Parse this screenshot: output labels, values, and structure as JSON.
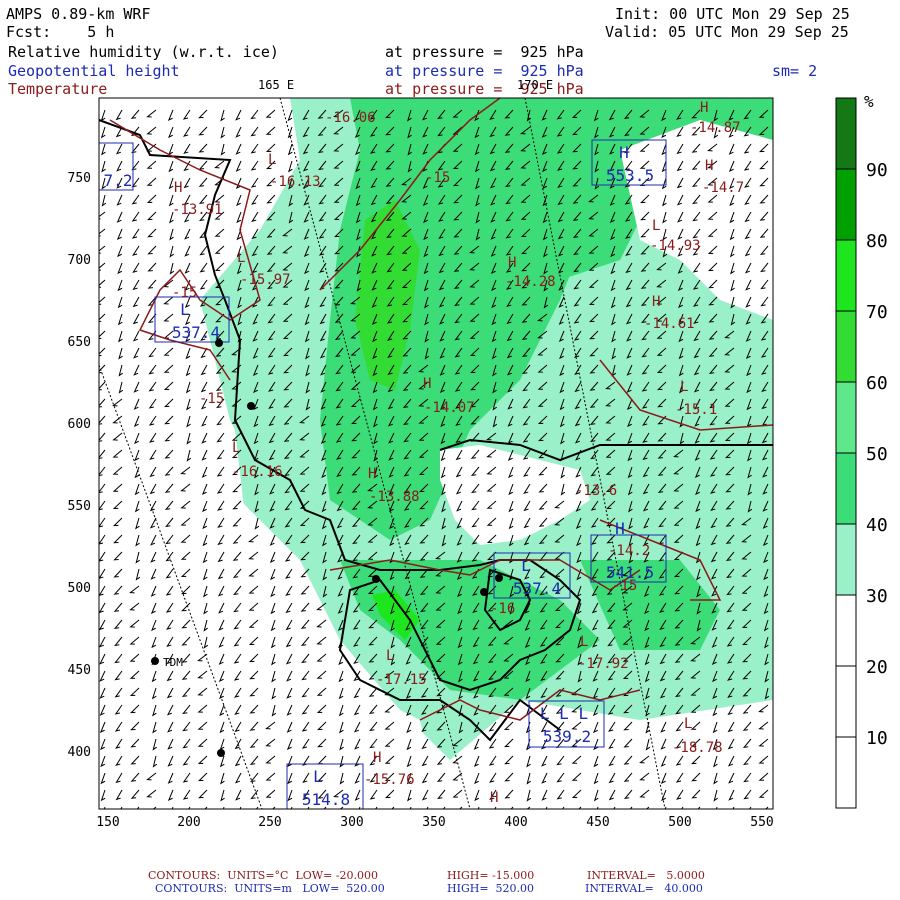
{
  "header": {
    "model": "AMPS 0.89-km WRF",
    "fcst": "Fcst:    5 h",
    "init": "Init: 00 UTC Mon 29 Sep 25",
    "valid": "Valid: 05 UTC Mon 29 Sep 25",
    "smoothing": "sm= 2",
    "fields": [
      {
        "name": "Relative humidity (w.r.t. ice)",
        "level": "at pressure =  925 hPa"
      },
      {
        "name": "Geopotential height",
        "level": "at pressure =  925 hPa"
      },
      {
        "name": "Temperature",
        "level": "at pressure =  925 hPa"
      }
    ]
  },
  "map": {
    "lon_labels": [
      "165 E",
      "170 E"
    ],
    "x_ticks": [
      "150",
      "200",
      "250",
      "300",
      "350",
      "400",
      "450",
      "500",
      "550"
    ],
    "y_ticks": [
      "750",
      "700",
      "650",
      "600",
      "550",
      "500",
      "450",
      "400"
    ],
    "stations": [
      {
        "name": "TDM"
      }
    ],
    "temp_labels": [
      "-16.06",
      "-15",
      "L",
      "-16.13",
      "H",
      "-13.91",
      "L",
      "-15.97",
      "-15",
      "-15",
      "L",
      "-16.16",
      "H",
      "-14.28",
      "H",
      "-14.07",
      "H",
      "-13.88",
      "H",
      "-14.87",
      "H",
      "-14.7",
      "L",
      "-14.93",
      "H",
      "-14.61",
      "L",
      "-15.1",
      "-13.6",
      "-14.2",
      "-15",
      "-16",
      "L",
      "-17.15",
      "L",
      "-17.92",
      "L",
      "-18.78",
      "H",
      "-15.76",
      "H"
    ],
    "height_boxes": [
      {
        "label": "H",
        "value": "553.5"
      },
      {
        "label": "L",
        "value": "537.4"
      },
      {
        "label": "L",
        "value": "537.4"
      },
      {
        "label": "H",
        "value": "541.5"
      },
      {
        "label": "L L L",
        "value": "539.2"
      },
      {
        "label": "L",
        "value": "514.8"
      },
      {
        "label": "",
        "value": "7.2"
      }
    ]
  },
  "colorbar": {
    "unit": "%",
    "ticks": [
      "90",
      "80",
      "70",
      "60",
      "50",
      "40",
      "30",
      "20",
      "10"
    ],
    "colors": [
      "#147814",
      "#00a000",
      "#1ee61e",
      "#32dc32",
      "#5fe88a",
      "#3cdc78",
      "#9af0c8",
      "#ffffff",
      "#ffffff",
      "#ffffff"
    ]
  },
  "footer": {
    "line1": {
      "a": "CONTOURS:  UNITS=°C  LOW= -20.000",
      "b": "HIGH= -15.000",
      "c": "INTERVAL=   5.0000"
    },
    "line2": {
      "a": "CONTOURS:  UNITS=m   LOW=  520.00",
      "b": "HIGH=  520.00",
      "c": "INTERVAL=   40.000"
    }
  }
}
